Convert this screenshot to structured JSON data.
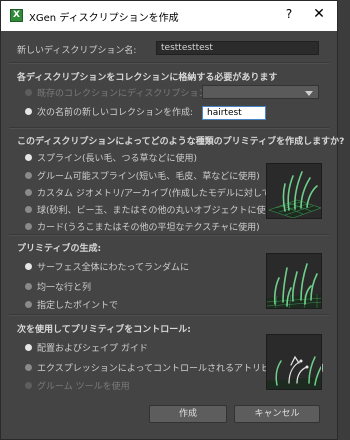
{
  "window": {
    "title": "XGen ディスクリプションを作成",
    "app_icon_letter": "X",
    "help_glyph": "?",
    "close_glyph": "✕"
  },
  "description": {
    "label": "新しいディスクリプション名:",
    "value": "testtesttest"
  },
  "collection": {
    "heading": "各ディスクリプションをコレクションに格納する必要があります",
    "add_existing_label": "既存のコレクションにディスクリプションを追加:",
    "create_new_label": "次の名前の新しいコレクションを作成:",
    "new_value": "hairtest",
    "selected": "create_new"
  },
  "primitive_type": {
    "heading": "このディスクリプションによってどのような種類のプリミティブを作成しますか?",
    "options": [
      {
        "label": "スプライン(長い毛、つる草などに使用)",
        "selected": true
      },
      {
        "label": "グルーム可能スプライン(短い毛、毛皮、草などに使用)",
        "selected": false
      },
      {
        "label": "カスタム ジオメトリ/アーカイブ(作成したモデルに対して使用)",
        "selected": false
      },
      {
        "label": "球(砂利、ビー玉、またはその他の丸いオブジェクトに使用)",
        "selected": false
      },
      {
        "label": "カード(うろこまたはその他の平坦なテクスチャに使用)",
        "selected": false
      }
    ]
  },
  "generation": {
    "heading": "プリミティブの生成:",
    "options": [
      {
        "label": "サーフェス全体にわたってランダムに",
        "selected": true
      },
      {
        "label": "均一な行と列",
        "selected": false
      },
      {
        "label": "指定したポイントで",
        "selected": false
      }
    ]
  },
  "control": {
    "heading": "次を使用してプリミティブをコントロール:",
    "options": [
      {
        "label": "配置およびシェイプ ガイド",
        "selected": true,
        "disabled": false
      },
      {
        "label": "エクスプレッションによってコントロールされるアトリビュートを使用",
        "selected": false,
        "disabled": false
      },
      {
        "label": "グルーム ツールを使用",
        "selected": false,
        "disabled": true
      }
    ]
  },
  "buttons": {
    "create": "作成",
    "cancel": "キャンセル"
  },
  "colors": {
    "dialog_bg": "#444444",
    "field_bg": "#2b2b2b",
    "accent_focus": "#4a86c5",
    "preview_green": "#4fb06a"
  }
}
